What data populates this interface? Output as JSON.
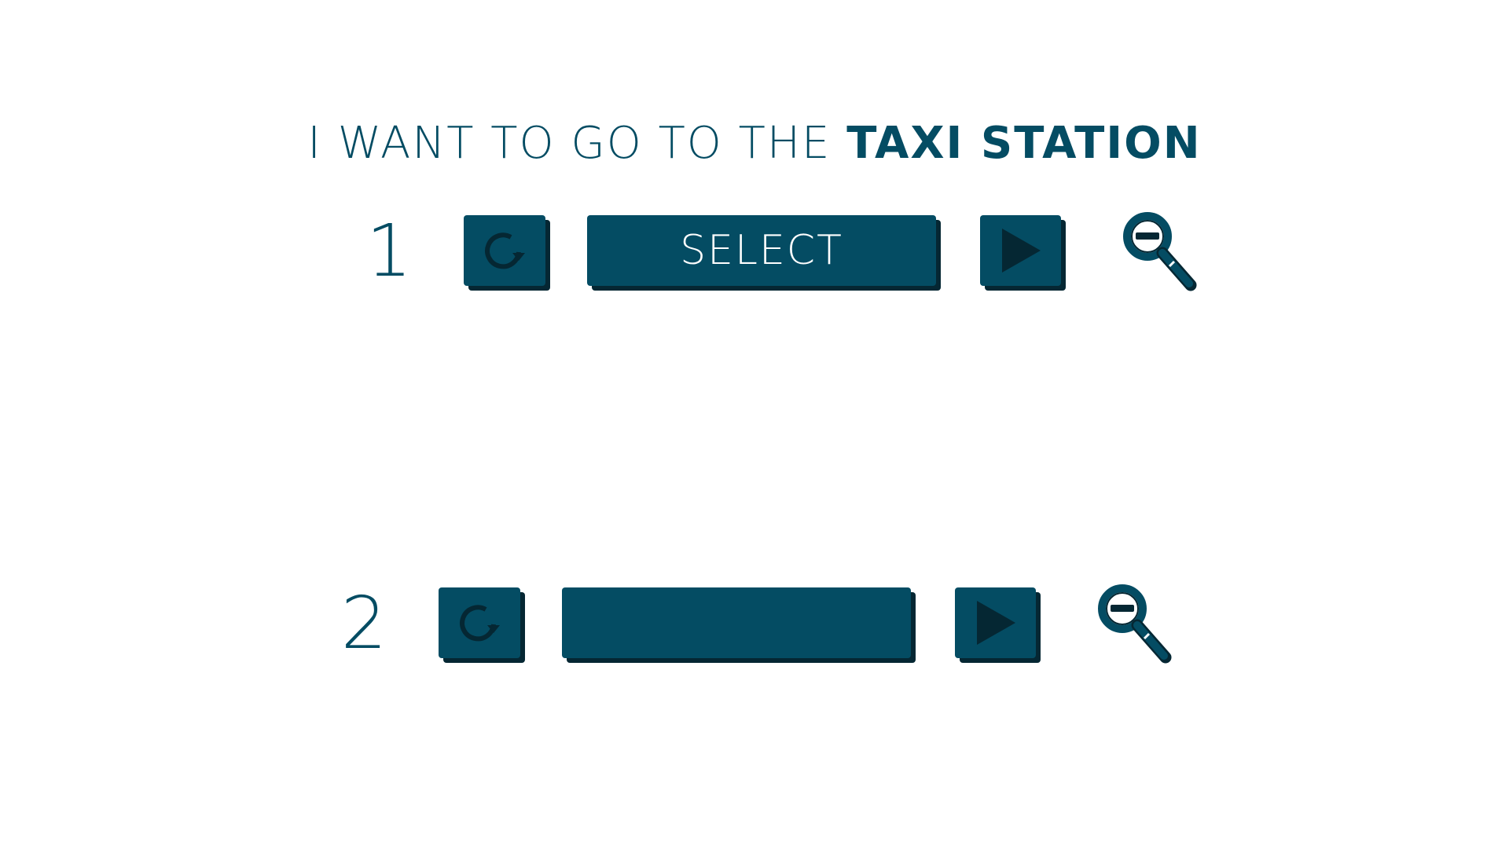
{
  "prompt": {
    "prefix": "I WANT TO GO TO THE ",
    "destination": "TAXI STATION"
  },
  "rows": [
    {
      "number": "1",
      "refresh_icon": "refresh-icon",
      "select_label": "SELECT",
      "play_icon": "play-icon",
      "zoom_icon": "zoom-out-icon"
    },
    {
      "number": "2",
      "refresh_icon": "refresh-icon",
      "select_label": "",
      "play_icon": "play-icon",
      "zoom_icon": "zoom-out-icon"
    }
  ],
  "colors": {
    "primary": "#044c63",
    "shadow": "#052733",
    "icon_dark": "#052733",
    "background": "#ffffff"
  }
}
